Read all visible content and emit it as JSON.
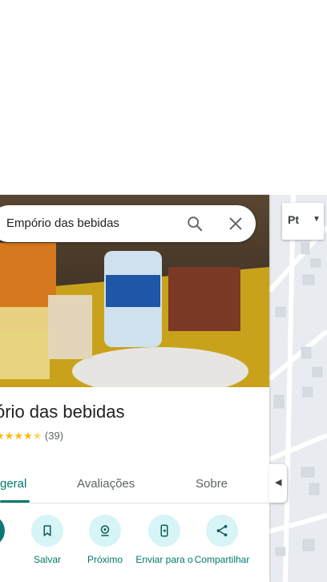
{
  "search": {
    "query": "Empório das bebidas"
  },
  "place": {
    "title": "ório das bebidas",
    "rating_stars": 4.5,
    "review_count": "(39)"
  },
  "tabs": [
    {
      "label": "geral"
    },
    {
      "label": "Avaliações"
    },
    {
      "label": "Sobre"
    }
  ],
  "actions": [
    {
      "label": "s",
      "icon": "directions-icon"
    },
    {
      "label": "Salvar",
      "icon": "bookmark-icon"
    },
    {
      "label": "Próximo",
      "icon": "nearby-icon"
    },
    {
      "label": "Enviar para o",
      "icon": "send-to-phone-icon"
    },
    {
      "label": "Compartilhar",
      "icon": "share-icon"
    }
  ],
  "map": {
    "layer_label": "Pt"
  },
  "colors": {
    "accent": "#00796b",
    "action_bg": "#d7f4f6",
    "star": "#fbbc04"
  }
}
